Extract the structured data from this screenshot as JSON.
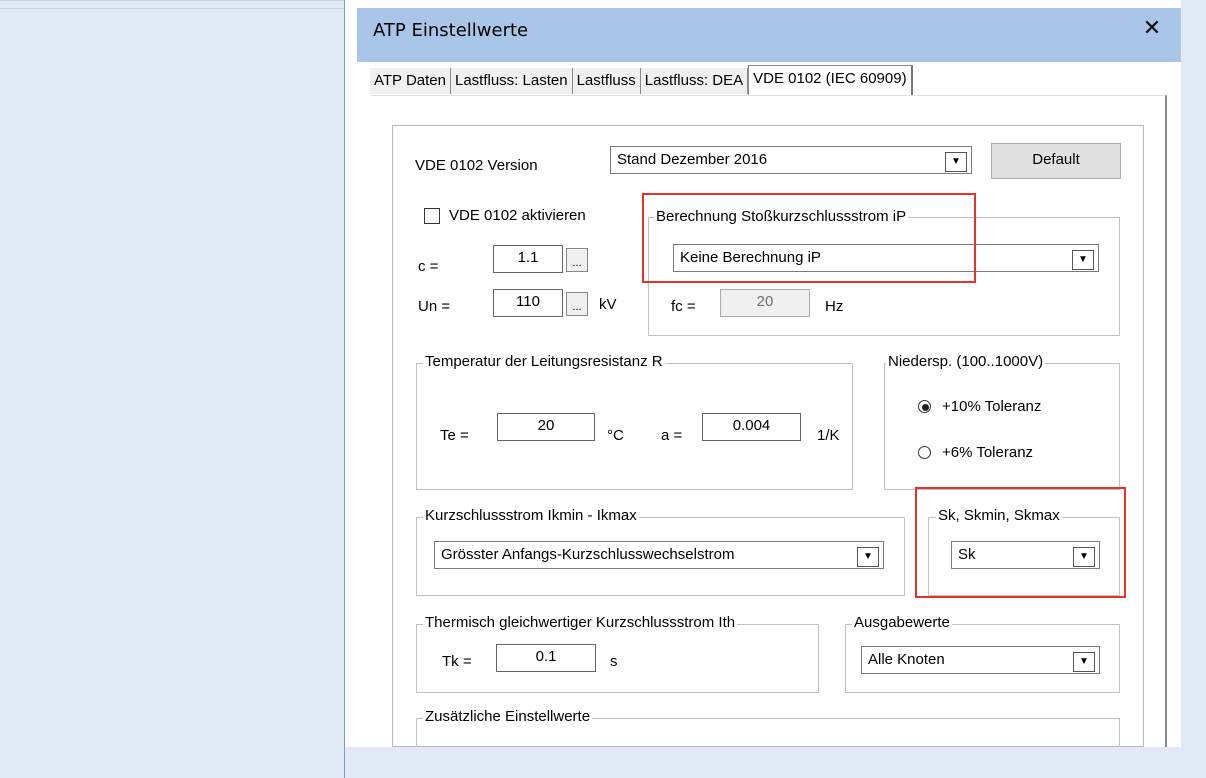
{
  "window": {
    "title": "ATP Einstellwerte",
    "close_glyph": "✕"
  },
  "tabs": [
    "ATP Daten",
    "Lastfluss: Lasten",
    "Lastfluss",
    "Lastfluss: DEA",
    "VDE 0102 (IEC 60909)"
  ],
  "vde": {
    "version_label": "VDE 0102 Version",
    "version_value": "Stand Dezember 2016",
    "default_button": "Default",
    "activate_label": "VDE 0102 aktivieren",
    "c_label": "c =",
    "c_value": "1.1",
    "un_label": "Un =",
    "un_value": "110",
    "un_unit": "kV",
    "dots": "..."
  },
  "ip_group": {
    "title": "Berechnung Stoßkurzschlussstrom iP",
    "select_value": "Keine Berechnung iP",
    "fc_label": "fc =",
    "fc_value": "20",
    "fc_unit": "Hz"
  },
  "temp_group": {
    "title": "Temperatur der Leitungsresistanz R",
    "te_label": "Te =",
    "te_value": "20",
    "te_unit": "°C",
    "a_label": "a =",
    "a_value": "0.004",
    "a_unit": "1/K"
  },
  "niedersp_group": {
    "title": "Niedersp. (100..1000V)",
    "option1": "+10% Toleranz",
    "option2": "+6% Toleranz"
  },
  "ik_group": {
    "title": "Kurzschlussstrom Ikmin - Ikmax",
    "select_value": "Grösster Anfangs-Kurzschlusswechselstrom"
  },
  "sk_group": {
    "title": "Sk, Skmin, Skmax",
    "select_value": "Sk"
  },
  "ith_group": {
    "title": "Thermisch gleichwertiger Kurzschlussstrom Ith",
    "tk_label": "Tk =",
    "tk_value": "0.1",
    "tk_unit": "s"
  },
  "ausgabe_group": {
    "title": "Ausgabewerte",
    "select_value": "Alle Knoten"
  },
  "extra_group": {
    "title": "Zusätzliche Einstellwerte"
  },
  "icons": {
    "dropdown_arrow": "▼"
  }
}
